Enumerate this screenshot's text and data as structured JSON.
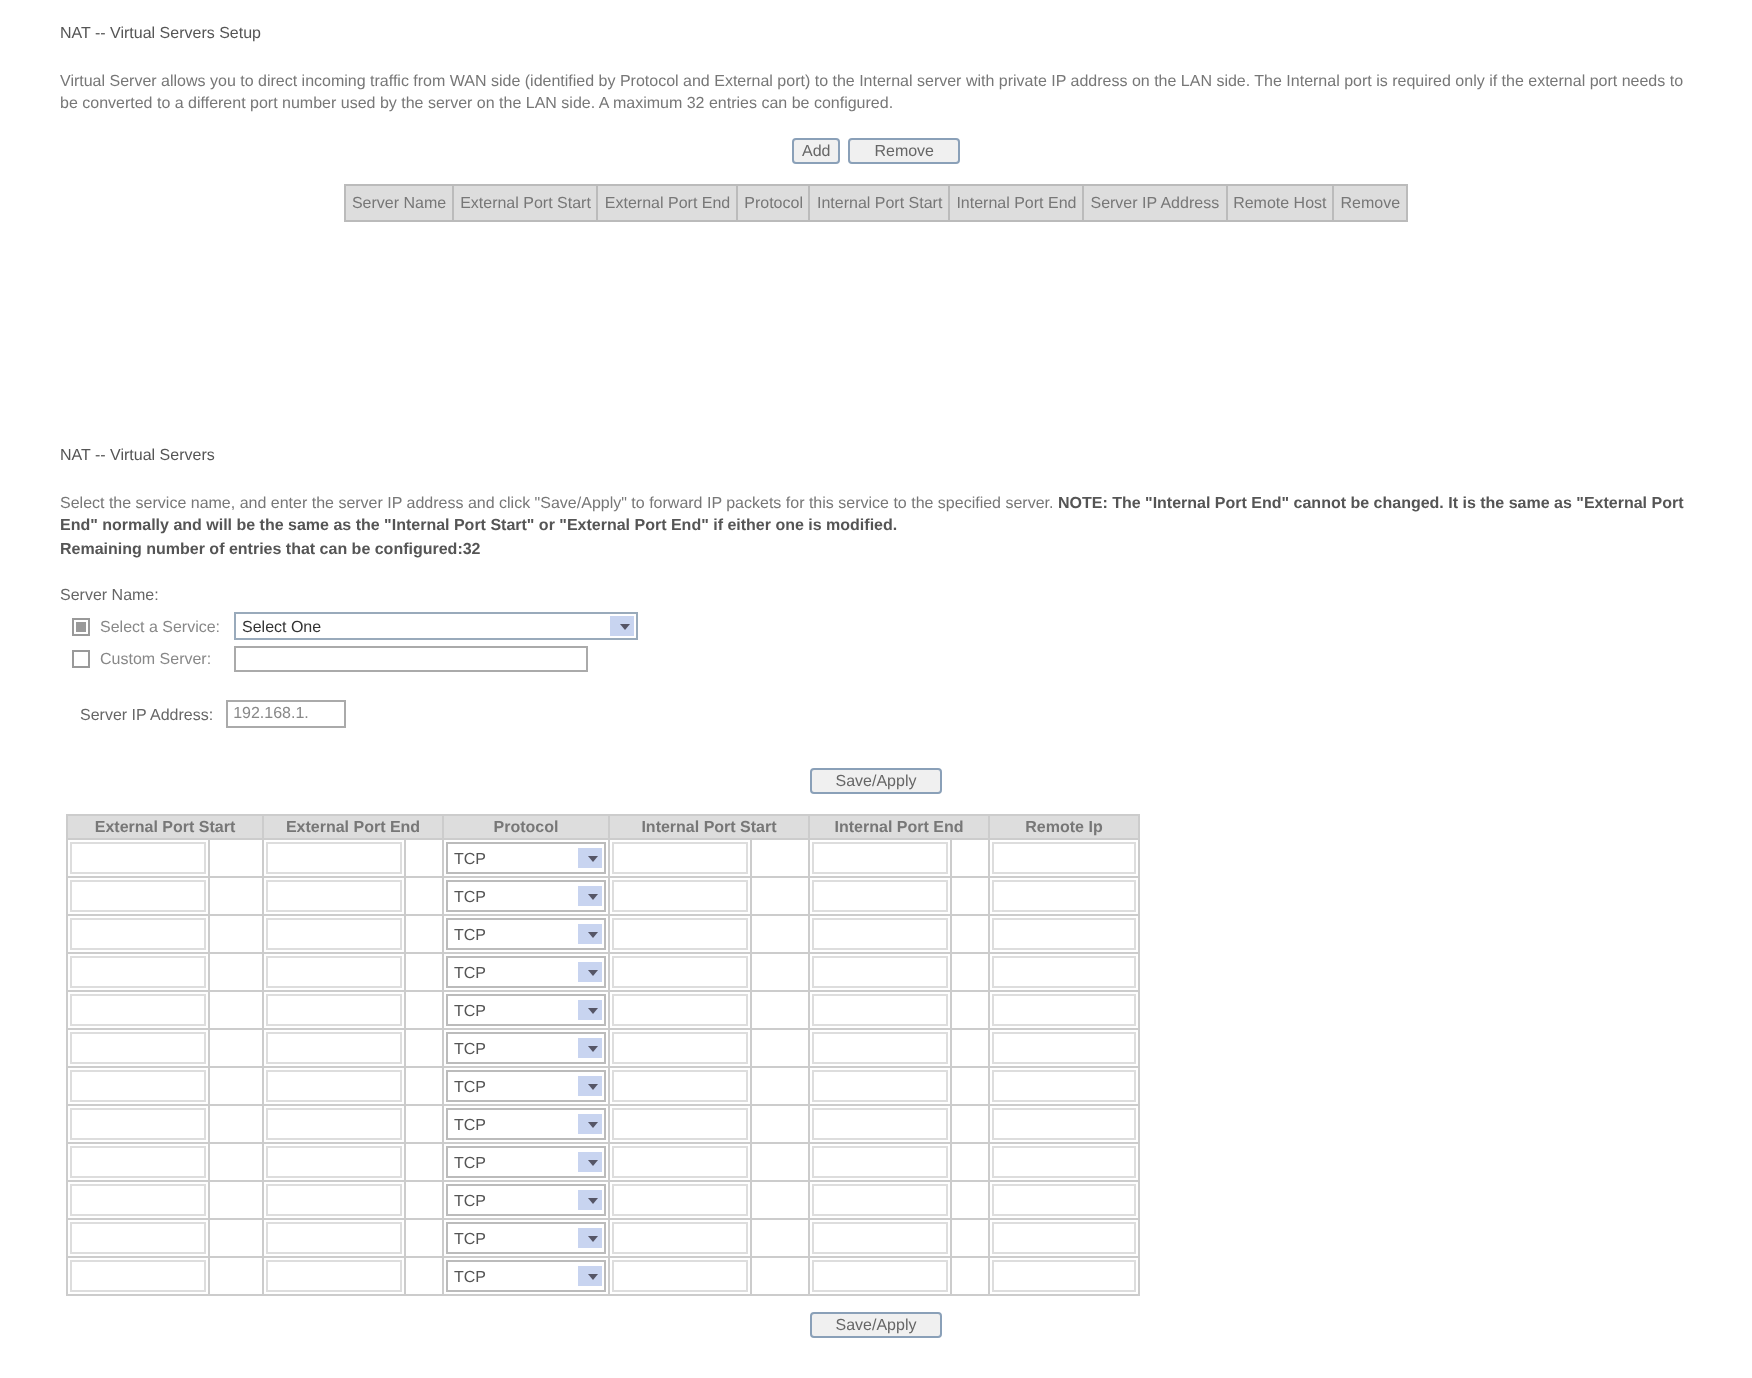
{
  "setup": {
    "title": "NAT -- Virtual Servers Setup",
    "description": "Virtual Server allows you to direct incoming traffic from WAN side (identified by Protocol and External port) to the Internal server with private IP address on the LAN side. The Internal port is required only if the external port needs to be converted to a different port number used by the server on the LAN side. A maximum 32 entries can be configured.",
    "buttons": [
      "Add",
      "Remove"
    ],
    "columns": [
      "Server Name",
      "External Port Start",
      "External Port End",
      "Protocol",
      "Internal Port Start",
      "Internal Port End",
      "Server IP Address",
      "Remote Host",
      "Remove"
    ]
  },
  "form": {
    "title": "NAT -- Virtual Servers",
    "description": "Select the service name, and enter the server IP address and click \"Save/Apply\" to forward IP packets for this service to the specified server. **NOTE: The \"Internal Port End\" cannot be changed. It is the same as \"External Port End\" normally and will be the same as the \"Internal Port Start\" or \"External Port End\" if either one is modified.**",
    "remaining": "Remaining number of entries that can be configured:32",
    "server_name_label": "Server Name:",
    "options": [
      {
        "kind": "select",
        "label": "Select a Service:",
        "value": "Select One",
        "selected": true
      },
      {
        "kind": "text",
        "label": "Custom Server:",
        "selected": false
      }
    ],
    "ip_label": "Server IP Address:",
    "ip_value": "192.168.1.",
    "button": "Save/Apply",
    "columns": [
      "External Port Start",
      "External Port End",
      "Protocol",
      "Internal Port Start",
      "Internal Port End",
      "Remote Ip"
    ],
    "rows": [
      {
        "protocol": "TCP"
      },
      {
        "protocol": "TCP"
      },
      {
        "protocol": "TCP"
      },
      {
        "protocol": "TCP"
      },
      {
        "protocol": "TCP"
      },
      {
        "protocol": "TCP"
      },
      {
        "protocol": "TCP"
      },
      {
        "protocol": "TCP"
      },
      {
        "protocol": "TCP"
      },
      {
        "protocol": "TCP"
      },
      {
        "protocol": "TCP"
      },
      {
        "protocol": "TCP"
      }
    ],
    "bottom_button": "Save/Apply"
  }
}
